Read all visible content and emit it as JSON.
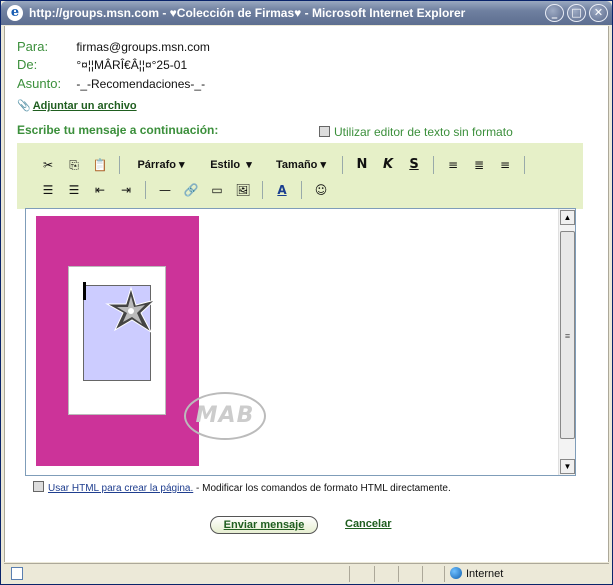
{
  "window": {
    "title": "http://groups.msn.com - ♥Colección de Firmas♥ - Microsoft Internet Explorer",
    "minimize": "_",
    "maximize": "□",
    "close": "✕"
  },
  "header": {
    "to_label": "Para:",
    "to_value": "firmas@groups.msn.com",
    "from_label": "De:",
    "from_value": "°¤¦¦MÂRÎ€Â¦¦¤°25-01",
    "subject_label": "Asunto:",
    "subject_value": "-_-Recomendaciones-_-"
  },
  "attach_label": "Adjuntar un archivo",
  "compose_prompt": "Escribe tu mensaje a continuación:",
  "plaintext_label": "Utilizar editor de texto sin formato",
  "toolbar": {
    "paragraph": "Párrafo",
    "style": "Estilo",
    "size": "Tamaño",
    "bold": "N",
    "italic": "K",
    "strike": "S",
    "icons": [
      "cut-icon",
      "copy-icon",
      "paste-icon",
      "align-left-icon",
      "align-center-icon",
      "align-right-icon",
      "numbered-list-icon",
      "bullet-list-icon",
      "outdent-icon",
      "indent-icon",
      "horizontal-rule-icon",
      "link-icon",
      "table-icon",
      "image-icon",
      "text-color-icon",
      "emoticon-icon"
    ]
  },
  "editor": {
    "watermark": "MAB"
  },
  "html_option": {
    "link": "Usar HTML para crear la página.",
    "desc": " - Modificar los comandos de formato HTML directamente."
  },
  "actions": {
    "send": "Enviar mensaje",
    "cancel": "Cancelar"
  },
  "status": {
    "zone": "Internet"
  }
}
